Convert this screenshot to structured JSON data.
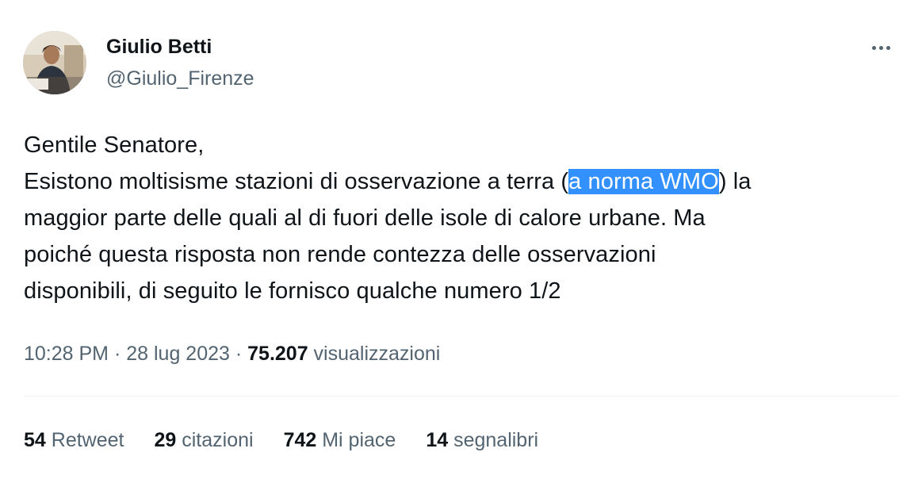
{
  "author": {
    "name": "Giulio Betti",
    "handle": "@Giulio_Firenze"
  },
  "tweet": {
    "line1": "Gentile Senatore,",
    "line2_before": "Esistono moltisisme stazioni di osservazione a terra (",
    "line2_highlight": "a norma WMO",
    "line2_after": ") la",
    "line3": "maggior parte delle quali al di fuori delle isole di calore urbane.  Ma",
    "line4": "poiché questa risposta non rende contezza delle osservazioni",
    "line5": "disponibili, di seguito le fornisco qualche numero 1/2"
  },
  "meta": {
    "time": "10:28 PM",
    "sep1": " · ",
    "date": "28 lug 2023",
    "sep2": " · ",
    "views_count": "75.207",
    "views_label": " visualizzazioni"
  },
  "stats": {
    "retweets_count": "54",
    "retweets_label": " Retweet",
    "quotes_count": "29",
    "quotes_label": " citazioni",
    "likes_count": "742",
    "likes_label": " Mi piace",
    "bookmarks_count": "14",
    "bookmarks_label": " segnalibri"
  },
  "colors": {
    "text_primary": "#0f1419",
    "text_secondary": "#536471",
    "selection_highlight": "#3390ff",
    "divider": "#eff3f4"
  },
  "icons": {
    "more": "more-horizontal-icon"
  }
}
